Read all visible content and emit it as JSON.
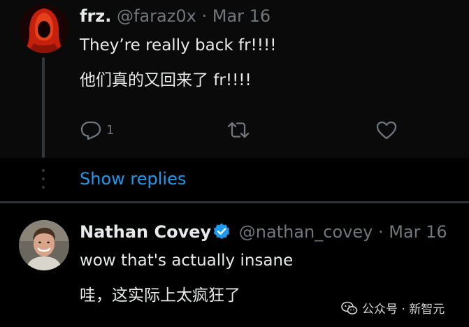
{
  "tweet1": {
    "author_name": "frz.",
    "handle": "@faraz0x",
    "separator": "·",
    "date": "Mar 16",
    "text_en": "They’re really back fr!!!!",
    "text_zh": "他们真的又回来了 fr!!!!",
    "reply_count": "1",
    "avatar_icon": "red-hooded-figure-avatar"
  },
  "show_replies": {
    "label": "Show replies"
  },
  "tweet2": {
    "author_name": "Nathan Covey",
    "handle": "@nathan_covey",
    "separator": "·",
    "date": "Mar 16",
    "text_en": "wow that's actually insane",
    "text_zh": "哇，这实际上太疯狂了",
    "avatar_icon": "man-photo-avatar",
    "verified_color": "#1d9bf0"
  },
  "watermark": {
    "text": "公众号 · 新智元"
  },
  "colors": {
    "background": "#000000",
    "text": "#e7e9ea",
    "muted": "#71767b",
    "link": "#1d9bf0",
    "divider": "#2f3336"
  }
}
